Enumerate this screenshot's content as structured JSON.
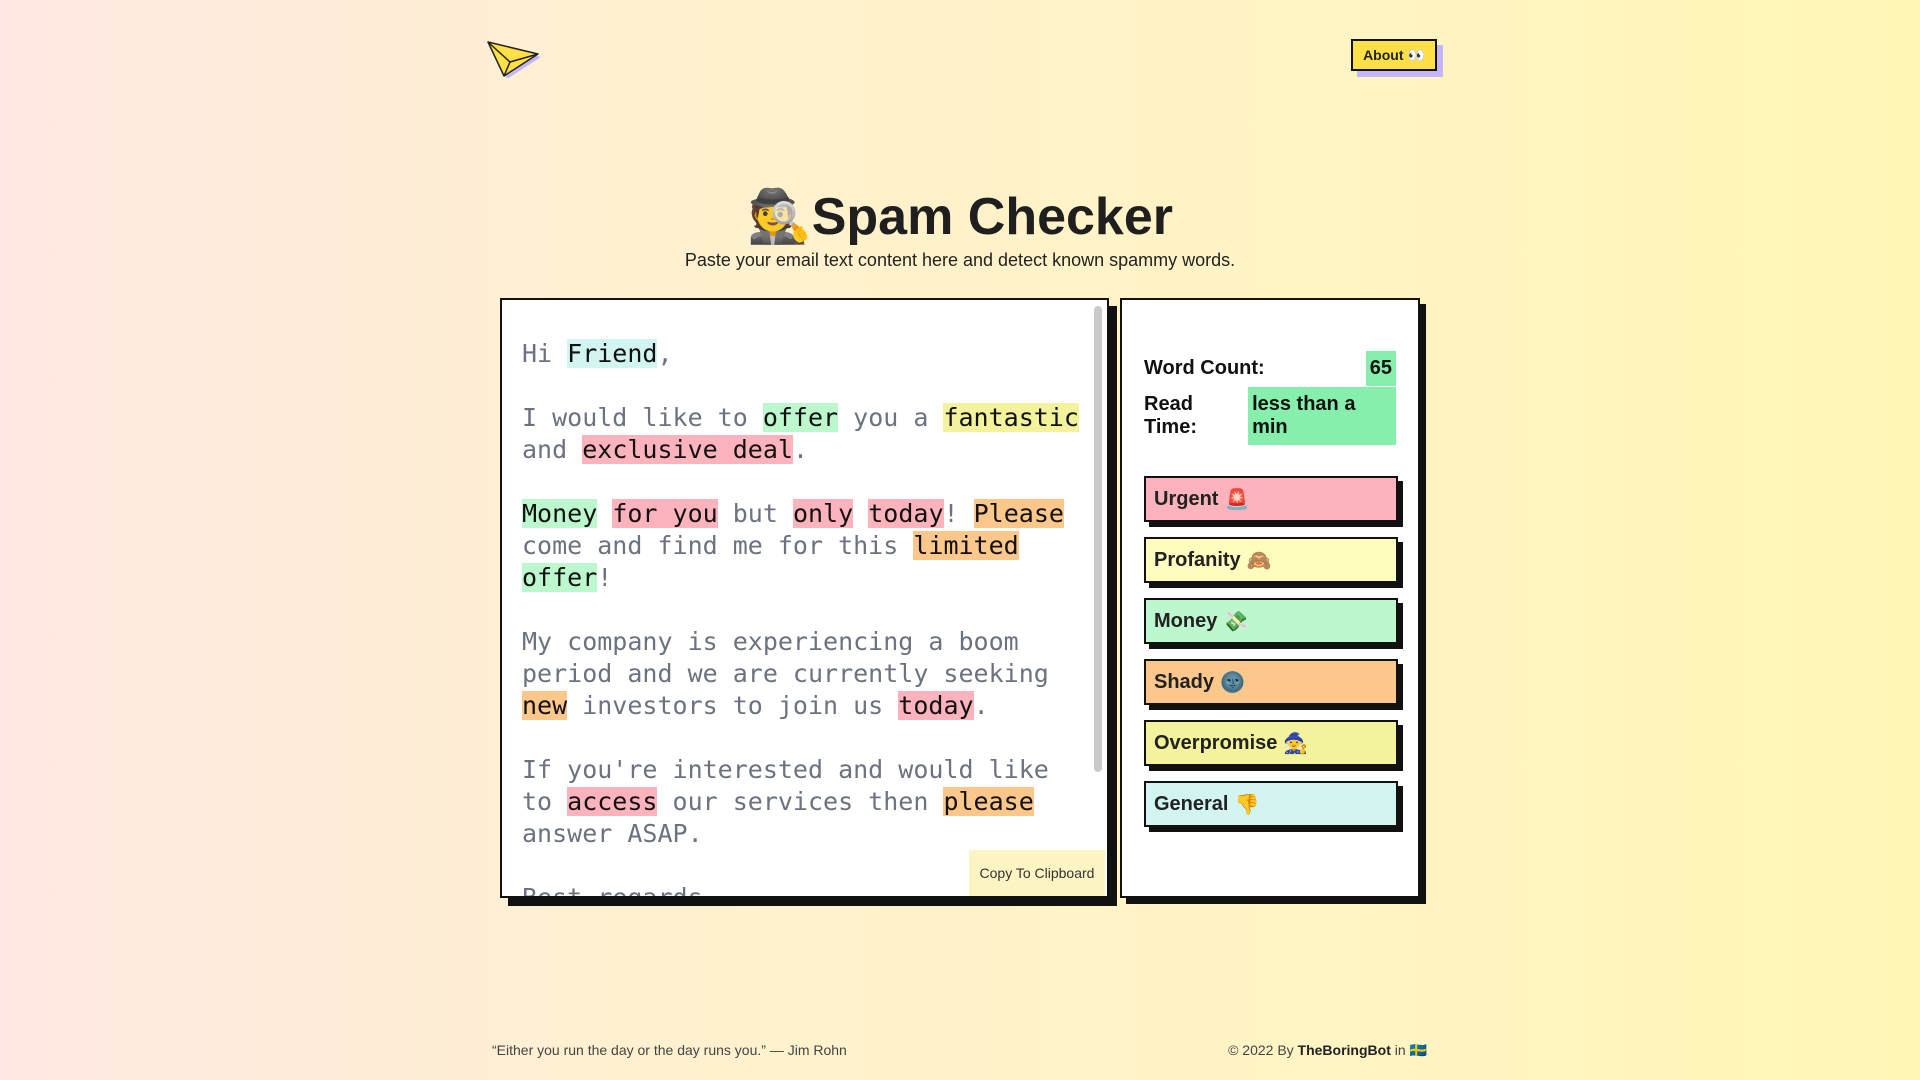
{
  "header": {
    "about_label": "About",
    "about_emoji": "👀"
  },
  "hero": {
    "emoji": "🕵️",
    "title": "Spam Checker",
    "subtitle": "Paste your email text content here and detect known spammy words."
  },
  "editor": {
    "paragraphs": [
      [
        [
          "Hi ",
          ""
        ],
        [
          "Friend",
          "cyan"
        ],
        [
          ",",
          ""
        ]
      ],
      [
        [
          "I would like to ",
          ""
        ],
        [
          "offer",
          "green"
        ],
        [
          " you a ",
          ""
        ],
        [
          "fantastic",
          "yellow"
        ],
        [
          " and ",
          ""
        ],
        [
          "exclusive deal",
          "red"
        ],
        [
          ".",
          ""
        ]
      ],
      [
        [
          "Money",
          "green"
        ],
        [
          " ",
          ""
        ],
        [
          "for you",
          "red"
        ],
        [
          " but ",
          ""
        ],
        [
          "only",
          "red"
        ],
        [
          " ",
          ""
        ],
        [
          "today",
          "red"
        ],
        [
          "! ",
          ""
        ],
        [
          "Please",
          "orange"
        ],
        [
          " come and find me for this ",
          ""
        ],
        [
          "limited",
          "orange"
        ],
        [
          " ",
          ""
        ],
        [
          "offer",
          "green"
        ],
        [
          "!",
          ""
        ]
      ],
      [
        [
          "My company is experiencing a boom period and we are currently seeking ",
          ""
        ],
        [
          "new",
          "orange"
        ],
        [
          " investors to join us ",
          ""
        ],
        [
          "today",
          "red"
        ],
        [
          ".",
          ""
        ]
      ],
      [
        [
          "If you're interested and would like to ",
          ""
        ],
        [
          "access",
          "red"
        ],
        [
          " our services then ",
          ""
        ],
        [
          "please",
          "orange"
        ],
        [
          " answer ASAP.",
          ""
        ]
      ],
      [
        [
          "Best regards",
          ""
        ]
      ]
    ],
    "copy_label": "Copy To Clipboard"
  },
  "stats": {
    "word_count_label": "Word Count:",
    "word_count_value": "65",
    "read_time_label": "Read Time:",
    "read_time_value": "less than a min",
    "categories": [
      {
        "label": "Urgent",
        "emoji": "🚨",
        "color": "#fdb3bd"
      },
      {
        "label": "Profanity",
        "emoji": "🙈",
        "color": "#fefcbf"
      },
      {
        "label": "Money",
        "emoji": "💸",
        "color": "#bdf7cd"
      },
      {
        "label": "Shady",
        "emoji": "🌚",
        "color": "#fcc78a"
      },
      {
        "label": "Overpromise",
        "emoji": "🧙",
        "color": "#f2f39c"
      },
      {
        "label": "General",
        "emoji": "👎",
        "color": "#d2f5f2"
      }
    ]
  },
  "footer": {
    "quote": "“Either you run the day or the day runs you.” — Jim Rohn",
    "copyright_prefix": "© 2022 By ",
    "brand": "TheBoringBot",
    "copyright_suffix": " in ",
    "flag": "🇸🇪"
  }
}
